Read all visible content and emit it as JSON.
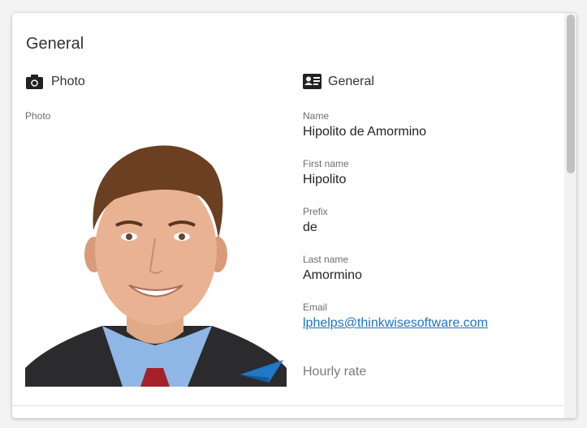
{
  "card": {
    "title": "General"
  },
  "photo_section": {
    "heading": "Photo",
    "icon": "camera-icon",
    "field_label": "Photo"
  },
  "general_section": {
    "heading": "General",
    "icon": "contact-card-icon",
    "fields": [
      {
        "label": "Name",
        "value": "Hipolito de Amormino"
      },
      {
        "label": "First name",
        "value": "Hipolito"
      },
      {
        "label": "Prefix",
        "value": "de"
      },
      {
        "label": "Last name",
        "value": "Amormino"
      },
      {
        "label": "Email",
        "value": "lphelps@thinkwisesoftware.com"
      }
    ],
    "next_field_label": "Hourly rate"
  },
  "colors": {
    "link": "#1a73c9",
    "card_bg": "#ffffff",
    "page_bg": "#f3f3f3"
  }
}
